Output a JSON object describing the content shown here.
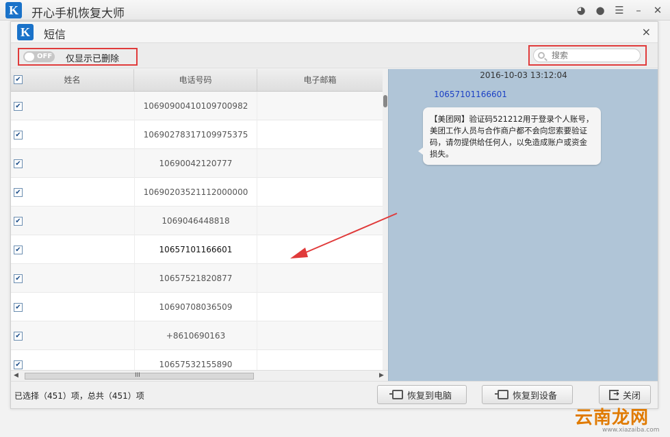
{
  "app": {
    "logo_letter": "K",
    "title": "开心手机恢复大师"
  },
  "dialog": {
    "logo_letter": "K",
    "title": "短信",
    "close": "×"
  },
  "toolbar": {
    "toggle_state": "OFF",
    "toggle_label": "仅显示已删除",
    "search_placeholder": "搜索"
  },
  "table": {
    "columns": [
      "姓名",
      "电话号码",
      "电子邮箱"
    ],
    "rows": [
      {
        "phone": "10690900410109700982"
      },
      {
        "phone": "10690278317109975375"
      },
      {
        "phone": "10690042120777"
      },
      {
        "phone": "10690203521112000000"
      },
      {
        "phone": "1069046448818"
      },
      {
        "phone": "10657101166601"
      },
      {
        "phone": "10657521820877"
      },
      {
        "phone": "10690708036509"
      },
      {
        "phone": "+8610690163"
      },
      {
        "phone": "10657532155890"
      }
    ],
    "hscroll_grip": "III"
  },
  "message": {
    "time": "2016-10-03 13:12:04",
    "sender": "10657101166601",
    "body": "【美团网】验证码521212用于登录个人账号，美团工作人员与合作商户都不会向您索要验证码，请勿提供给任何人，以免造成账户或资金损失。"
  },
  "footer": {
    "status": "已选择（451）项，总共（451）项",
    "restore_pc": "恢复到电脑",
    "restore_device": "恢复到设备",
    "close": "关闭"
  },
  "watermark": {
    "text": "云南龙网",
    "sub": "www.xiazaiba.com"
  },
  "colors": {
    "accent": "#1a72c9",
    "highlight_box": "#e03a3a",
    "message_bg": "#b0c5d7",
    "sender": "#1a3fc4"
  }
}
